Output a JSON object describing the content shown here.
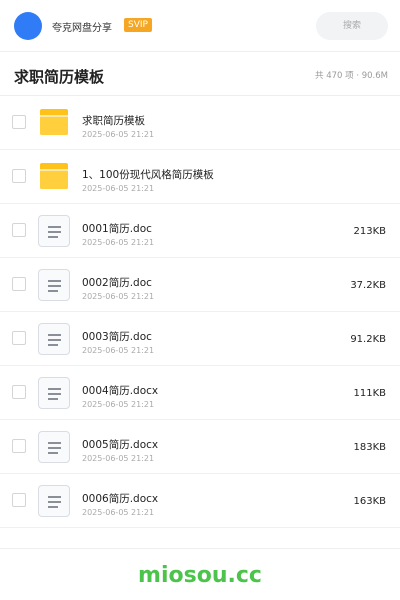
{
  "header": {
    "user_name": "夸克网盘分享",
    "badge": "SVIP",
    "search_placeholder": "搜索",
    "avatar_color": "#2f7cf6"
  },
  "title_bar": {
    "title": "求职简历模板",
    "stats": "共 470 项 · 90.6M"
  },
  "files": [
    {
      "type": "folder",
      "name": "求职简历模板",
      "date": "2025-06-05 21:21",
      "size": ""
    },
    {
      "type": "folder",
      "name": "1、100份现代风格简历模板",
      "date": "2025-06-05 21:21",
      "size": ""
    },
    {
      "type": "doc",
      "name": "0001简历.doc",
      "date": "2025-06-05 21:21",
      "size": "213KB"
    },
    {
      "type": "doc",
      "name": "0002简历.doc",
      "date": "2025-06-05 21:21",
      "size": "37.2KB"
    },
    {
      "type": "doc",
      "name": "0003简历.doc",
      "date": "2025-06-05 21:21",
      "size": "91.2KB"
    },
    {
      "type": "doc",
      "name": "0004简历.docx",
      "date": "2025-06-05 21:21",
      "size": "111KB"
    },
    {
      "type": "doc",
      "name": "0005简历.docx",
      "date": "2025-06-05 21:21",
      "size": "183KB"
    },
    {
      "type": "doc",
      "name": "0006简历.docx",
      "date": "2025-06-05 21:21",
      "size": "163KB"
    }
  ],
  "footer": {
    "brand": "miosou.cc",
    "brand_color": "#4cc34a"
  }
}
